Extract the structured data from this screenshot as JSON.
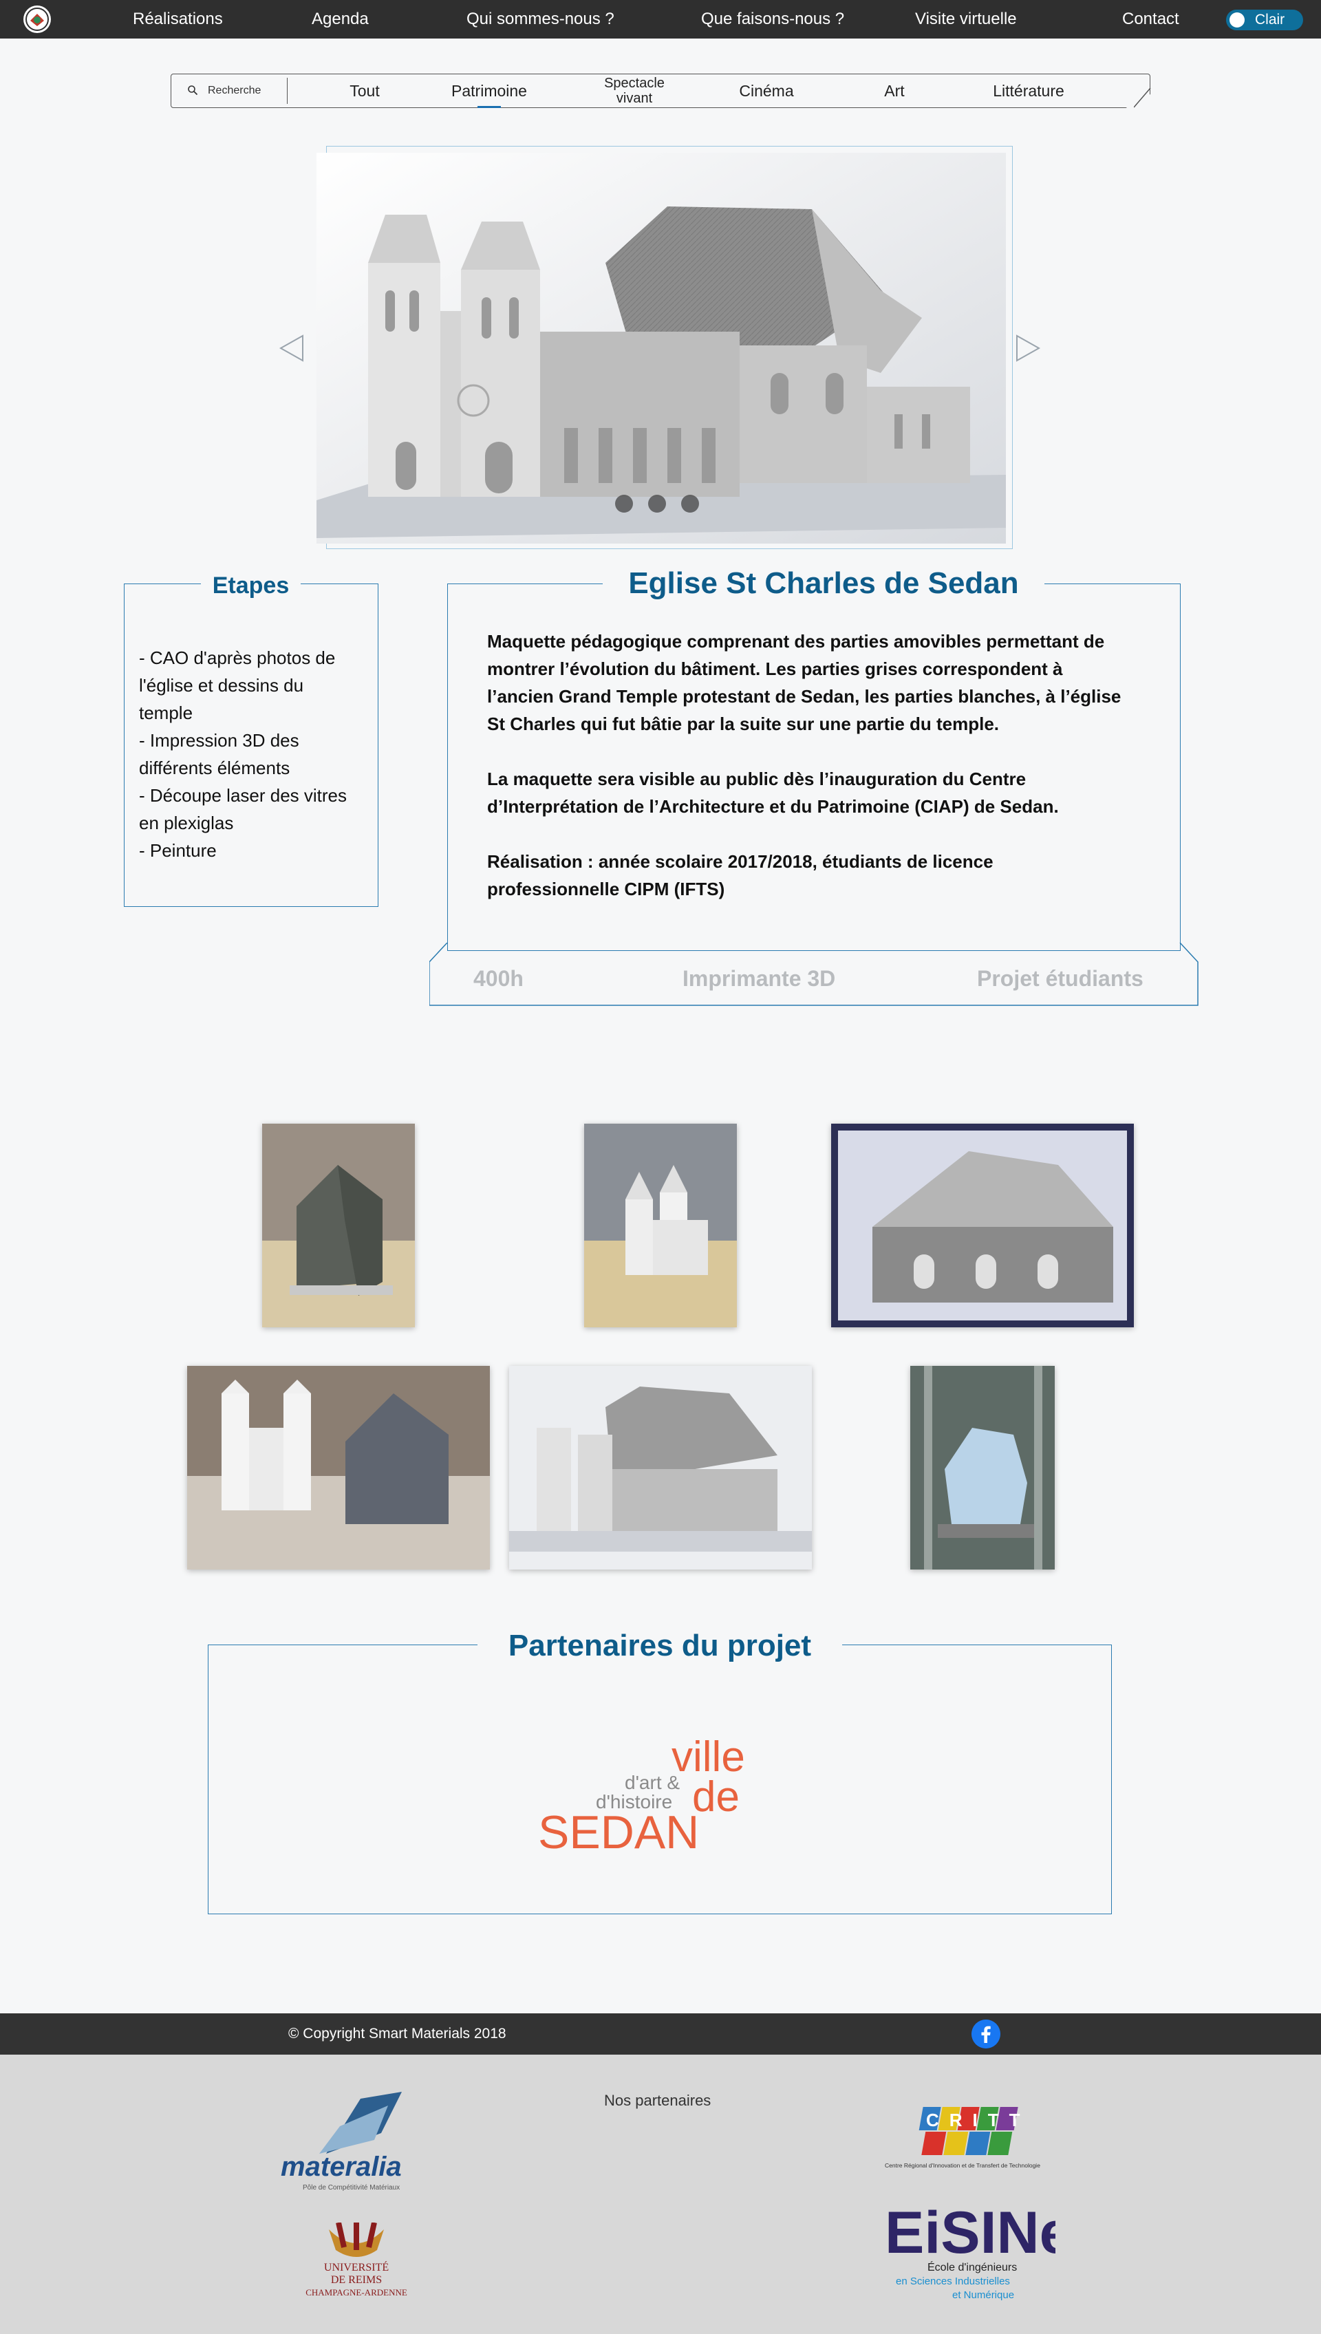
{
  "nav": {
    "items": [
      "Réalisations",
      "Agenda",
      "Qui sommes-nous ?",
      "Que faisons-nous ?",
      "Visite virtuelle",
      "Contact"
    ],
    "theme_toggle_label": "Clair"
  },
  "filters": {
    "search_placeholder": "Recherche",
    "items": [
      "Tout",
      "Patrimoine",
      "Spectacle",
      "vivant",
      "Cinéma",
      "Art",
      "Littérature"
    ],
    "active": "Patrimoine"
  },
  "etapes": {
    "title": "Etapes",
    "lines": [
      "- CAO d'après photos de",
      "l'église et dessins du",
      "temple",
      "- Impression 3D des",
      "différents éléments",
      "- Découpe laser des vitres",
      "en plexiglas",
      "- Peinture"
    ]
  },
  "project": {
    "title": "Eglise St Charles de Sedan",
    "paragraphs": [
      "Maquette pédagogique comprenant des parties amovibles permettant de montrer l’évolution du bâtiment. Les parties grises correspondent à l’ancien Grand Temple protestant de Sedan, les parties blanches, à l’église St Charles qui fut bâtie par la suite sur une partie du temple.",
      "La maquette sera visible au public dès l’inauguration du Centre d’Interprétation de l’Architecture et du Patrimoine (CIAP) de Sedan.",
      "Réalisation : année scolaire 2017/2018, étudiants de licence professionnelle CIPM (IFTS)"
    ],
    "tags": [
      "400h",
      "Imprimante 3D",
      "Projet étudiants"
    ]
  },
  "partners_section": {
    "title": "Partenaires du projet",
    "logo_text": {
      "ville": "ville",
      "de": "de",
      "dart": "d'art &",
      "dhistoire": "d'histoire",
      "sedan": "SEDAN"
    }
  },
  "footer": {
    "copyright": "© Copyright Smart Materials 2018",
    "partners_label": "Nos partenaires",
    "logos": {
      "materalia": "materalia",
      "materalia_sub": "Pôle de Compétitivité Matériaux",
      "critt": "CRITT",
      "critt_sub": "Centre Régional d'Innovation et de Transfert de Technologie",
      "urca_1": "UNIVERSITÉ",
      "urca_2": "DE REIMS",
      "urca_3": "CHAMPAGNE-ARDENNE",
      "eisine_main": "EiSINe",
      "eisine_1": "École d'ingénieurs",
      "eisine_2": "en Sciences Industrielles",
      "eisine_3": "et Numérique"
    }
  },
  "colors": {
    "accent": "#0e5c8a",
    "nav_bg": "#2f2f2f",
    "toggle": "#0e6f9b",
    "sedan_orange": "#e8623e"
  }
}
